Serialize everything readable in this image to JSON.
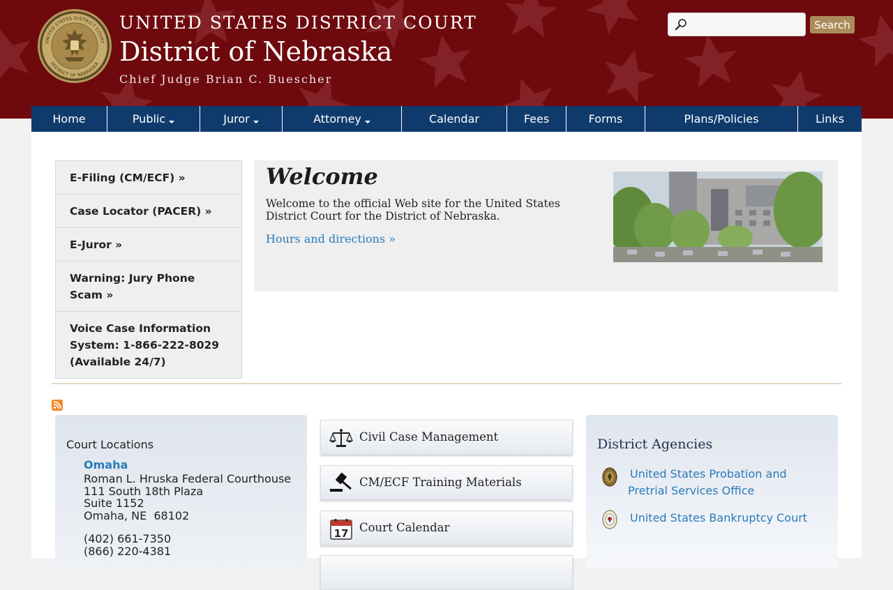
{
  "header": {
    "court_name": "UNITED STATES DISTRICT COURT",
    "district_name": "District of Nebraska",
    "chief_judge": "Chief Judge Brian C. Buescher",
    "seal_text_top": "UNITED STATES DISTRICT COURT",
    "seal_text_bottom": "DISTRICT OF NEBRASKA",
    "search_placeholder": "",
    "search_button": "Search"
  },
  "nav": {
    "items": [
      {
        "label": "Home",
        "dropdown": false
      },
      {
        "label": "Public",
        "dropdown": true
      },
      {
        "label": "Juror",
        "dropdown": true
      },
      {
        "label": "Attorney",
        "dropdown": true
      },
      {
        "label": "Calendar",
        "dropdown": false
      },
      {
        "label": "Fees",
        "dropdown": false
      },
      {
        "label": "Forms",
        "dropdown": false
      },
      {
        "label": "Plans/Policies",
        "dropdown": false
      },
      {
        "label": "Links",
        "dropdown": false
      }
    ]
  },
  "quicklinks": [
    "E-Filing (CM/ECF) »",
    "Case Locator (PACER) »",
    "E-Juror »",
    "Warning: Jury Phone Scam »",
    "Voice Case Information System: 1-866-222-8029 (Available 24/7)"
  ],
  "welcome": {
    "title": "Welcome",
    "body": "Welcome to the official Web site for the United States District Court for the District of Nebraska.",
    "link": "Hours and directions »"
  },
  "locations": {
    "title": "Court Locations",
    "city": "Omaha",
    "address": [
      "Roman L. Hruska Federal Courthouse",
      "111 South 18th Plaza",
      "Suite 1152",
      "Omaha, NE  68102"
    ],
    "phones": [
      "(402) 661-7350",
      "(866) 220-4381"
    ]
  },
  "cards": [
    {
      "label": "Civil Case Management",
      "icon": "scales-icon"
    },
    {
      "label": "CM/ECF Training Materials",
      "icon": "gavel-icon"
    },
    {
      "label": "Court Calendar",
      "icon": "calendar-icon",
      "icon_text": "17"
    }
  ],
  "agencies": {
    "title": "District Agencies",
    "items": [
      {
        "label": "United States Probation and Pretrial Services Office"
      },
      {
        "label": "United States Bankruptcy Court"
      }
    ]
  },
  "colors": {
    "header_bg": "#6e0a0e",
    "nav_bg": "#0f3a6c",
    "link": "#2a7ab8",
    "search_button": "#a98c5a"
  }
}
